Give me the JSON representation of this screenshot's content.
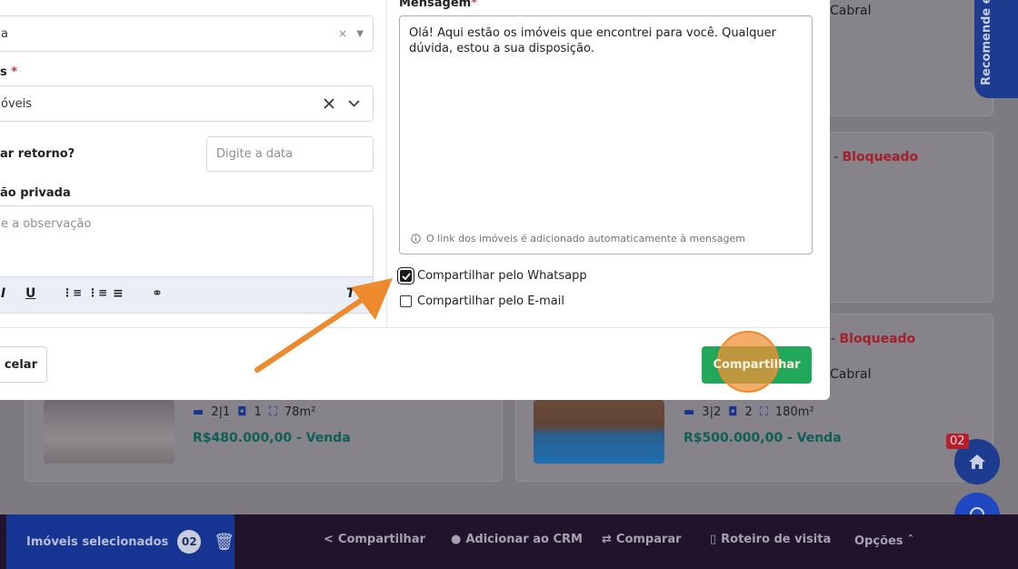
{
  "modal": {
    "field1": {
      "label": "",
      "value": "a"
    },
    "field2": {
      "label": "s",
      "value": "óveis"
    },
    "return_date": {
      "label": "ar retorno?",
      "placeholder": "Digite a data"
    },
    "private_note": {
      "label": "ão privada",
      "placeholder": "e a observação"
    },
    "message": {
      "label": "Mensagem",
      "text": "Olá! Aqui estão os imóveis que encontrei para você. Qualquer dúvida, estou a sua disposição.",
      "info": "O link dos imóveis é adicionado automaticamente à mensagem"
    },
    "share_whatsapp": {
      "label": "Compartilhar pelo Whatsapp",
      "checked": true
    },
    "share_email": {
      "label": "Compartilhar pelo E-mail",
      "checked": false
    },
    "cancel_label": "celar",
    "share_label": "Compartilhar"
  },
  "background": {
    "card1_top_text": "Cabral",
    "card2_status_dash": "-",
    "card2_status": "Bloqueado",
    "card3_status_dash": "-",
    "card3_status": "Bloqueado",
    "card3_text": "Cabral",
    "card_left": {
      "beds": "2|1",
      "cars": "1",
      "area": "78m²",
      "price": "R$480.000,00 - Venda"
    },
    "card_right": {
      "beds": "3|2",
      "cars": "2",
      "area": "180m²",
      "price": "R$500.000,00 - Venda"
    },
    "side_tab": "Recomende e",
    "badge": "02"
  },
  "bottom_bar": {
    "selected_label": "Imóveis selecionados",
    "selected_count": "02",
    "share": "Compartilhar",
    "crm": "Adicionar ao CRM",
    "compare": "Comparar",
    "route": "Roteiro de visita",
    "options": "Opções"
  },
  "colors": {
    "accent_green": "#22a85a",
    "primary_blue": "#163592",
    "highlight_orange": "#ee8a2e",
    "blocked_red": "#d0313d"
  }
}
